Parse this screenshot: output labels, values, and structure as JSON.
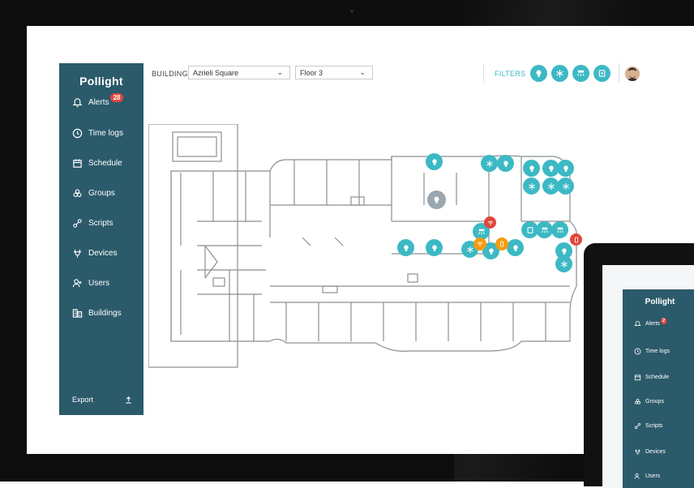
{
  "app": {
    "logo": "Pollight"
  },
  "sidebar": {
    "items": [
      {
        "label": "Alerts",
        "icon": "bell-icon",
        "badge": "28"
      },
      {
        "label": "Time logs",
        "icon": "clock-icon"
      },
      {
        "label": "Schedule",
        "icon": "calendar-icon"
      },
      {
        "label": "Groups",
        "icon": "groups-icon"
      },
      {
        "label": "Scripts",
        "icon": "scripts-icon"
      },
      {
        "label": "Devices",
        "icon": "plug-icon"
      },
      {
        "label": "Users",
        "icon": "users-icon"
      },
      {
        "label": "Buildings",
        "icon": "buildings-icon"
      }
    ],
    "export": {
      "label": "Export",
      "icon": "upload-icon"
    }
  },
  "topbar": {
    "building_label": "BUILDING",
    "building_value": "Azrieli Square",
    "floor_value": "Floor 3",
    "filters_label": "FILTERS",
    "filters": [
      "bulb-icon",
      "snowflake-icon",
      "fan-icon",
      "panel-icon"
    ],
    "avatar": "user-avatar"
  },
  "map": {
    "markers": [
      {
        "type": "bulb"
      },
      {
        "type": "snowflake"
      },
      {
        "type": "bulb"
      },
      {
        "type": "bulb"
      },
      {
        "type": "bulb"
      },
      {
        "type": "bulb"
      },
      {
        "type": "snowflake"
      },
      {
        "type": "snowflake"
      },
      {
        "type": "snowflake"
      },
      {
        "type": "fan"
      },
      {
        "type": "panel"
      },
      {
        "type": "fan"
      },
      {
        "type": "fan"
      },
      {
        "type": "bulb"
      },
      {
        "type": "bulb"
      },
      {
        "type": "snowflake"
      },
      {
        "type": "bulb"
      },
      {
        "type": "bulb"
      },
      {
        "type": "bulb"
      },
      {
        "type": "snowflake"
      },
      {
        "type": "wifi-alert"
      },
      {
        "type": "wifi-warning"
      },
      {
        "type": "phone-warning"
      },
      {
        "type": "phone-alert"
      },
      {
        "type": "bulb-selected"
      }
    ]
  },
  "tablet": {
    "logo": "Pollight",
    "items": [
      {
        "label": "Alerts",
        "badge": "2"
      },
      {
        "label": "Time logs"
      },
      {
        "label": "Schedule"
      },
      {
        "label": "Groups"
      },
      {
        "label": "Scripts"
      },
      {
        "label": "Devices"
      },
      {
        "label": "Users"
      }
    ]
  },
  "colors": {
    "sidebar": "#2b5a6b",
    "accent": "#3cb9c4",
    "warning": "#f39c12",
    "alert": "#e0463c"
  }
}
